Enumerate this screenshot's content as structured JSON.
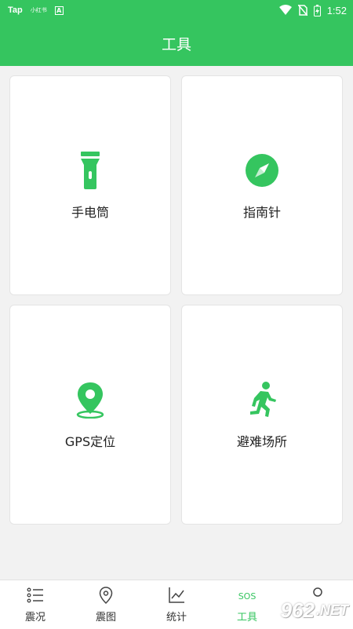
{
  "status_bar": {
    "left_items": [
      "Tap",
      "小红书",
      "A"
    ],
    "time": "1:52",
    "icons": [
      "wifi-icon",
      "no-sim-icon",
      "battery-charging-icon"
    ]
  },
  "app_bar": {
    "title": "工具"
  },
  "tools": [
    {
      "label": "手电筒",
      "icon": "flashlight-icon"
    },
    {
      "label": "指南针",
      "icon": "compass-icon"
    },
    {
      "label": "GPS定位",
      "icon": "location-pin-icon"
    },
    {
      "label": "避难场所",
      "icon": "running-person-icon"
    }
  ],
  "tabs": [
    {
      "label": "震况",
      "icon": "list-icon"
    },
    {
      "label": "震图",
      "icon": "map-pin-icon"
    },
    {
      "label": "统计",
      "icon": "chart-icon"
    },
    {
      "label": "工具",
      "icon": "sos-icon",
      "active": true
    },
    {
      "label": "",
      "icon": "profile-icon"
    }
  ],
  "watermark": {
    "text": "962",
    "suffix": ".NET"
  },
  "colors": {
    "primary": "#35c55f",
    "background": "#f2f2f2",
    "card": "#ffffff"
  }
}
